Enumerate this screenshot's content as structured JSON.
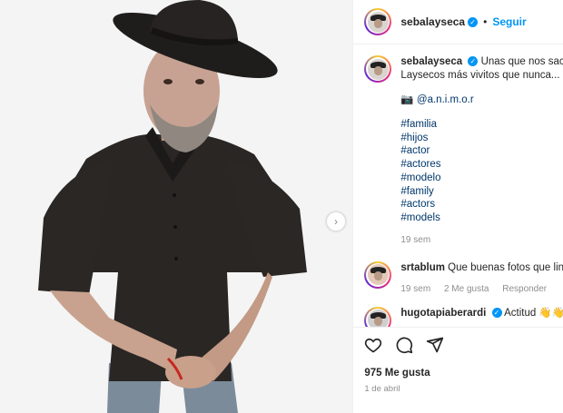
{
  "post": {
    "author": "sebalayseca",
    "follow_label": "Seguir",
    "separator": "•",
    "caption_line1": "Unas que nos sacan",
    "caption_line2": "Laysecos más vivitos que nunca...",
    "photo_credit_icon": "📷",
    "photo_credit": "@a.n.i.m.o.r",
    "hashtags": [
      "#familia",
      "#hijos",
      "#actor",
      "#actores",
      "#modelo",
      "#family",
      "#actors",
      "#models"
    ],
    "caption_age": "19 sem",
    "likes": "975 Me gusta",
    "date": "1 de abril"
  },
  "comments": [
    {
      "user": "srtablum",
      "text": "Que buenas fotos que lin",
      "age": "19 sem",
      "likes": "2 Me gusta",
      "reply": "Responder"
    },
    {
      "user": "hugotapiaberardi",
      "text": "Actitud 👋👋👋"
    }
  ],
  "icons": {
    "verified": "✓",
    "next": "›",
    "like": "heart-icon",
    "comment": "comment-icon",
    "share": "share-icon"
  },
  "colors": {
    "accent": "#0095f6",
    "link": "#00376b",
    "muted": "#8e8e8e"
  }
}
